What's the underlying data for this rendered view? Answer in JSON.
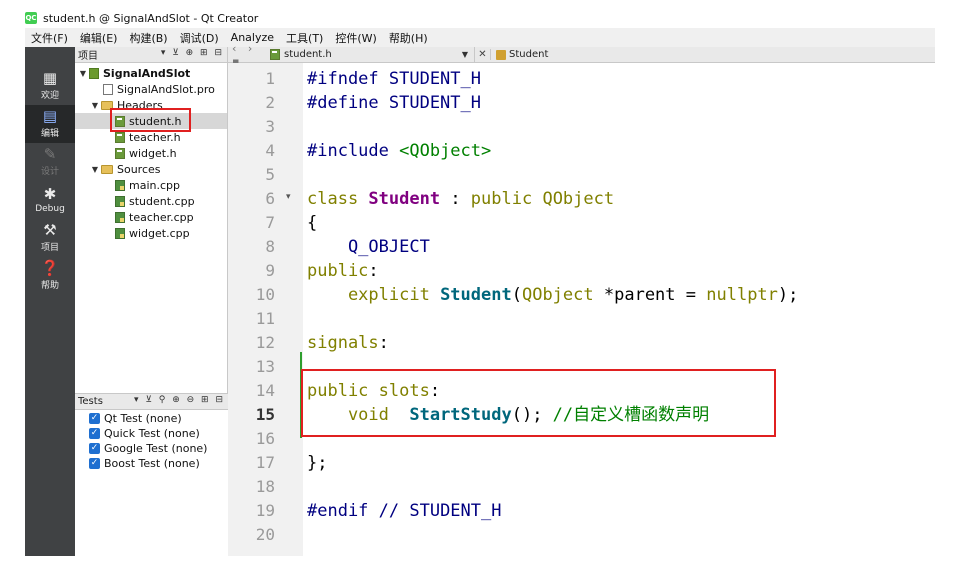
{
  "window": {
    "title": "student.h @ SignalAndSlot - Qt Creator",
    "logo_text": "QC"
  },
  "menu": [
    "文件(F)",
    "编辑(E)",
    "构建(B)",
    "调试(D)",
    "Analyze",
    "工具(T)",
    "控件(W)",
    "帮助(H)"
  ],
  "modes": [
    {
      "label": "欢迎",
      "icon": "welcome-grid-icon"
    },
    {
      "label": "编辑",
      "icon": "edit-document-icon"
    },
    {
      "label": "设计",
      "icon": "design-pen-icon"
    },
    {
      "label": "Debug",
      "icon": "debug-bug-icon"
    },
    {
      "label": "项目",
      "icon": "projects-wrench-icon"
    },
    {
      "label": "帮助",
      "icon": "help-question-icon"
    }
  ],
  "project_pane": {
    "title": "项目",
    "tree": [
      {
        "label": "SignalAndSlot",
        "kind": "project"
      },
      {
        "label": "SignalAndSlot.pro",
        "kind": "pro"
      },
      {
        "label": "Headers",
        "kind": "folder"
      },
      {
        "label": "student.h",
        "kind": "h"
      },
      {
        "label": "teacher.h",
        "kind": "h"
      },
      {
        "label": "widget.h",
        "kind": "h"
      },
      {
        "label": "Sources",
        "kind": "folder"
      },
      {
        "label": "main.cpp",
        "kind": "cpp"
      },
      {
        "label": "student.cpp",
        "kind": "cpp"
      },
      {
        "label": "teacher.cpp",
        "kind": "cpp"
      },
      {
        "label": "widget.cpp",
        "kind": "cpp"
      }
    ]
  },
  "tests_pane": {
    "title": "Tests",
    "items": [
      "Qt Test (none)",
      "Quick Test (none)",
      "Google Test (none)",
      "Boost Test (none)"
    ]
  },
  "editor": {
    "open_document": "student.h",
    "current_class": "Student",
    "current_line": 15,
    "lines": [
      [
        {
          "t": "#ifndef STUDENT_H",
          "c": "pp"
        }
      ],
      [
        {
          "t": "#define STUDENT_H",
          "c": "pp"
        }
      ],
      [],
      [
        {
          "t": "#include ",
          "c": "pp"
        },
        {
          "t": "<QObject>",
          "c": "inc"
        }
      ],
      [],
      [
        {
          "t": "class ",
          "c": "kw"
        },
        {
          "t": "Student",
          "c": "ty"
        },
        {
          "t": " : ",
          "c": "pl"
        },
        {
          "t": "public ",
          "c": "kw"
        },
        {
          "t": "QObject",
          "c": "ty2"
        }
      ],
      [
        {
          "t": "{",
          "c": "pl"
        }
      ],
      [
        {
          "t": "    Q_OBJECT",
          "c": "mc"
        }
      ],
      [
        {
          "t": "public",
          "c": "kw"
        },
        {
          "t": ":",
          "c": "pl"
        }
      ],
      [
        {
          "t": "    explicit ",
          "c": "kw"
        },
        {
          "t": "Student",
          "c": "fn"
        },
        {
          "t": "(",
          "c": "pl"
        },
        {
          "t": "QObject",
          "c": "ty2"
        },
        {
          "t": " *",
          "c": "pl"
        },
        {
          "t": "parent",
          "c": "pl"
        },
        {
          "t": " = ",
          "c": "pl"
        },
        {
          "t": "nullptr",
          "c": "kw"
        },
        {
          "t": ");",
          "c": "pl"
        }
      ],
      [],
      [
        {
          "t": "signals",
          "c": "kw"
        },
        {
          "t": ":",
          "c": "pl"
        }
      ],
      [],
      [
        {
          "t": "public ",
          "c": "kw"
        },
        {
          "t": "slots",
          "c": "kw"
        },
        {
          "t": ":",
          "c": "pl"
        }
      ],
      [
        {
          "t": "    void  ",
          "c": "kw"
        },
        {
          "t": "StartStudy",
          "c": "fn"
        },
        {
          "t": "(); ",
          "c": "pl"
        },
        {
          "t": "//自定义槽函数声明",
          "c": "cm"
        }
      ],
      [],
      [
        {
          "t": "};",
          "c": "pl"
        }
      ],
      [],
      [
        {
          "t": "#endif ",
          "c": "pp"
        },
        {
          "t": "// STUDENT_H",
          "c": "pp"
        }
      ],
      []
    ]
  }
}
